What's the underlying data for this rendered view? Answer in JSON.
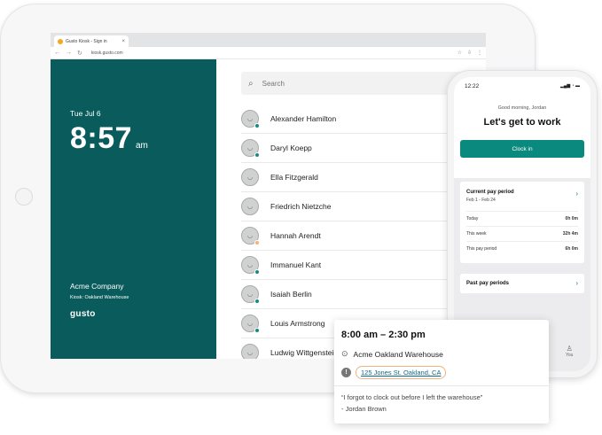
{
  "browser": {
    "tab_title": "Gusto Kiosk - Sign in",
    "url": "kiosk.gusto.com"
  },
  "kiosk": {
    "date": "Tue Jul 6",
    "time": "8:57",
    "ampm": "am",
    "company": "Acme Company",
    "kiosk_location": "Kiosk: Oakland Warehouse",
    "logo": "gusto",
    "search_placeholder": "Search",
    "employees": [
      {
        "name": "Alexander Hamilton",
        "status_color": "#1a8a7e"
      },
      {
        "name": "Daryl Koepp",
        "status_color": "#1a8a7e"
      },
      {
        "name": "Ella Fitzgerald",
        "status_color": ""
      },
      {
        "name": "Friedrich Nietzche",
        "status_color": ""
      },
      {
        "name": "Hannah Arendt",
        "status_color": "#f0b37a"
      },
      {
        "name": "Immanuel Kant",
        "status_color": "#1a8a7e"
      },
      {
        "name": "Isaiah Berlin",
        "status_color": "#1a8a7e"
      },
      {
        "name": "Louis Armstrong",
        "status_color": "#1a8a7e"
      },
      {
        "name": "Ludwig Wittgenstein",
        "status_color": ""
      }
    ]
  },
  "phone": {
    "status_time": "12:22",
    "greeting": "Good morning, Jordan",
    "headline": "Let's get to work",
    "clock_in_label": "Clock in",
    "pay_period_title": "Current pay period",
    "pay_period_range": "Feb 1 - Feb 24",
    "pay_rows": [
      {
        "label": "Today",
        "value": "0h 0m"
      },
      {
        "label": "This week",
        "value": "32h 4m"
      },
      {
        "label": "This pay period",
        "value": "6h 0m"
      }
    ],
    "past_title": "Past pay periods",
    "tab_you": "You"
  },
  "popover": {
    "time_range": "8:00 am – 2:30 pm",
    "location": "Acme Oakland Warehouse",
    "address": "125 Jones St. Oakland, CA",
    "quote": "“I forgot to clock out before I left the warehouse”",
    "author": "- Jordan Brown"
  },
  "colors": {
    "teal_dark": "#0a5b5c",
    "teal_button": "#0a8a7e",
    "warning_outline": "#f0b37a"
  }
}
